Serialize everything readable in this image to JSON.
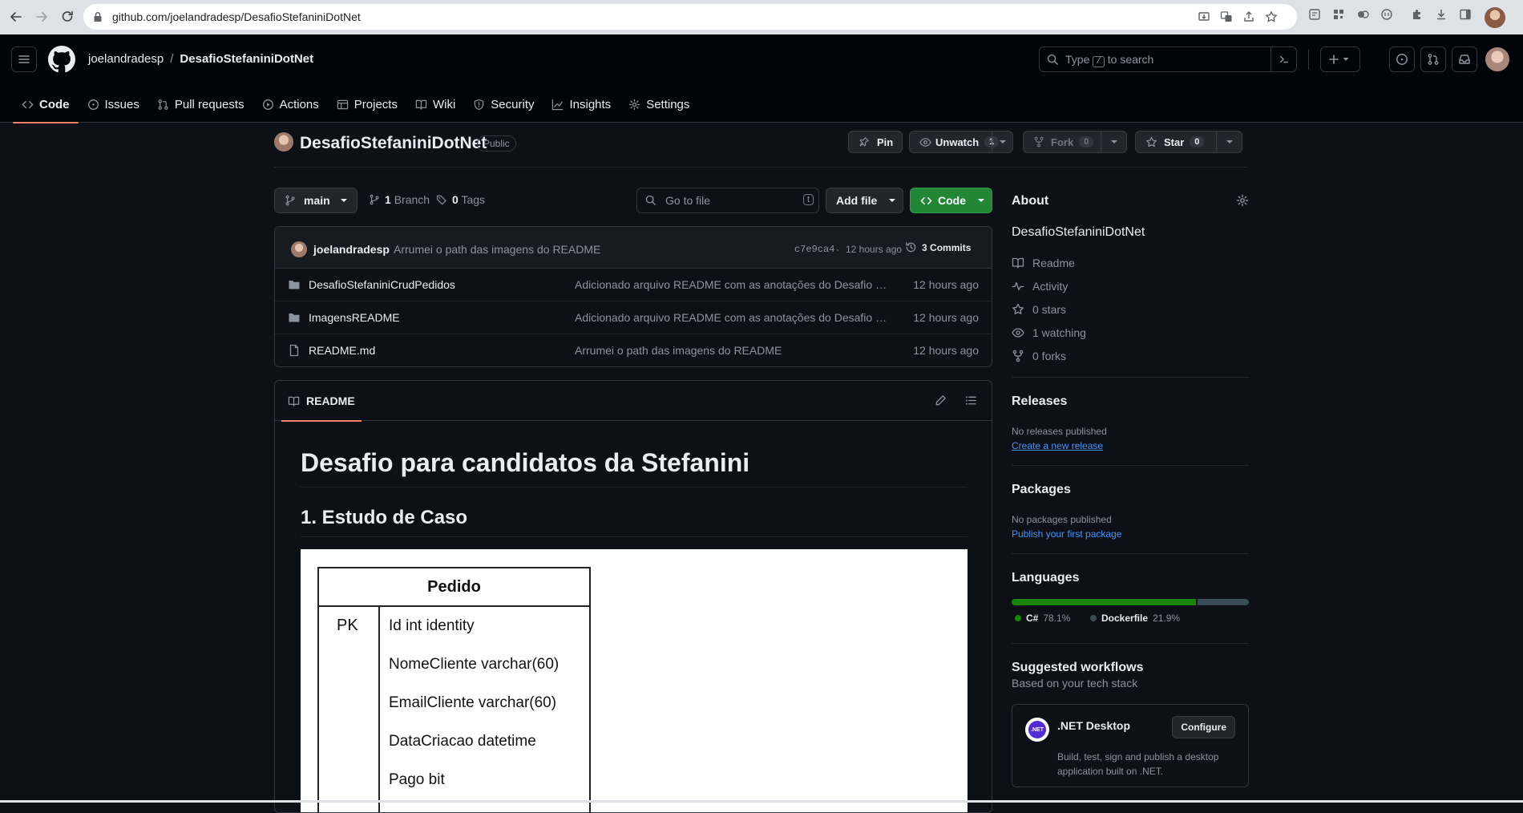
{
  "browser": {
    "url": "github.com/joelandradesp/DesafioStefaniniDotNet",
    "profile_initial": ""
  },
  "header": {
    "owner": "joelandradesp",
    "separator": "/",
    "repo": "DesafioStefaniniDotNet",
    "search_prefix": "Type",
    "search_key": "/",
    "search_suffix": "to search"
  },
  "nav_tabs": [
    {
      "label": "Code",
      "icon": "code-icon",
      "active": true
    },
    {
      "label": "Issues",
      "icon": "issue-icon"
    },
    {
      "label": "Pull requests",
      "icon": "pull-request-icon"
    },
    {
      "label": "Actions",
      "icon": "play-icon"
    },
    {
      "label": "Projects",
      "icon": "table-icon"
    },
    {
      "label": "Wiki",
      "icon": "book-icon"
    },
    {
      "label": "Security",
      "icon": "shield-icon"
    },
    {
      "label": "Insights",
      "icon": "graph-icon"
    },
    {
      "label": "Settings",
      "icon": "gear-icon"
    }
  ],
  "repo": {
    "name": "DesafioStefaniniDotNet",
    "visibility": "Public",
    "pin_label": "Pin",
    "unwatch_label": "Unwatch",
    "unwatch_count": "1",
    "fork_label": "Fork",
    "fork_count": "0",
    "star_label": "Star",
    "star_count": "0"
  },
  "toolbar": {
    "branch": "main",
    "branch_count": "1",
    "branch_label": "Branch",
    "tag_count": "0",
    "tag_label": "Tags",
    "goto_placeholder": "Go to file",
    "goto_key": "t",
    "add_file": "Add file",
    "code": "Code"
  },
  "last_commit": {
    "author": "joelandradesp",
    "message": "Arrumei o path das imagens do README",
    "hash": "c7e9ca4",
    "dot": "·",
    "time": "12 hours ago",
    "commits_count": "3",
    "commits_label": "Commits"
  },
  "files": [
    {
      "name": "DesafioStefaniniCrudPedidos",
      "type": "folder",
      "message": "Adicionado arquivo README com as anotações do Desafio S...",
      "time": "12 hours ago"
    },
    {
      "name": "ImagensREADME",
      "type": "folder",
      "message": "Adicionado arquivo README com as anotações do Desafio S...",
      "time": "12 hours ago"
    },
    {
      "name": "README.md",
      "type": "file",
      "message": "Arrumei o path das imagens do README",
      "time": "12 hours ago"
    }
  ],
  "readme": {
    "tab": "README",
    "h1": "Desafio para candidatos da Stefanini",
    "h2": "1. Estudo de Caso",
    "diagram": {
      "table_name": "Pedido",
      "key": "PK",
      "fields": [
        "Id int identity",
        "NomeCliente varchar(60)",
        "EmailCliente varchar(60)",
        "DataCriacao datetime",
        "Pago bit"
      ]
    }
  },
  "sidebar": {
    "about_title": "About",
    "repo_name": "DesafioStefaniniDotNet",
    "items": [
      {
        "label": "Readme",
        "icon": "book-icon"
      },
      {
        "label": "Activity",
        "icon": "pulse-icon"
      },
      {
        "label": "0 stars",
        "icon": "star-icon"
      },
      {
        "label": "1 watching",
        "icon": "eye-icon"
      },
      {
        "label": "0 forks",
        "icon": "fork-icon"
      }
    ],
    "releases_title": "Releases",
    "releases_empty": "No releases published",
    "releases_link": "Create a new release",
    "packages_title": "Packages",
    "packages_empty": "No packages published",
    "packages_link": "Publish your first package",
    "languages_title": "Languages",
    "languages": [
      {
        "name": "C#",
        "percent": "78.1%",
        "value": 78.1,
        "color": "#178600"
      },
      {
        "name": "Dockerfile",
        "percent": "21.9%",
        "value": 21.9,
        "color": "#384d54"
      }
    ],
    "workflows_title": "Suggested workflows",
    "workflows_subtitle": "Based on your tech stack",
    "workflow": {
      "logo_text": ".NET",
      "name": ".NET Desktop",
      "configure": "Configure",
      "description_line1": "Build, test, sign and publish a desktop",
      "description_line2": "application built on .NET."
    }
  }
}
